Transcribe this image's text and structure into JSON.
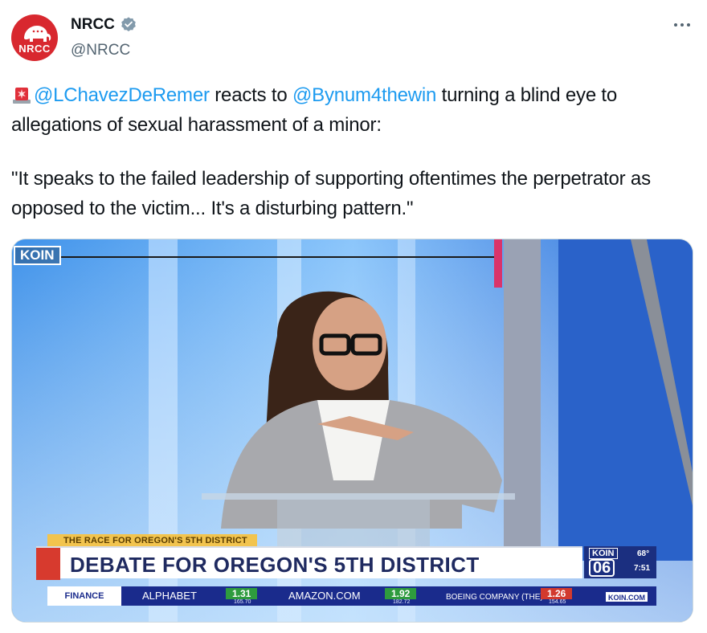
{
  "author": {
    "display_name": "NRCC",
    "handle": "@NRCC",
    "avatar_text": "NRCC",
    "verified": true
  },
  "tweet": {
    "line1_prefix_icon": "rotating-light-emoji",
    "mention_1": "@LChavezDeRemer",
    "text_1": " reacts to ",
    "mention_2": "@Bynum4thewin",
    "text_2": " turning a blind eye to allegations of sexual harassment of a minor:",
    "quote": "\"It speaks to the failed leadership of supporting oftentimes the perpetrator as opposed to the victim... It's a disturbing pattern.\""
  },
  "media": {
    "channel_bug": "KOIN",
    "lower_third_tag": "THE RACE FOR OREGON'S 5TH DISTRICT",
    "lower_third_title": "DEBATE FOR OREGON'S 5TH DISTRICT",
    "station_logo": "KOIN",
    "station_number": "06",
    "temperature": "68°",
    "time": "7:51",
    "ticker_label": "FINANCE",
    "ticker": [
      {
        "name": "ALPHABET",
        "change": "1.31",
        "price": "165.70",
        "color": "#2e9b3e"
      },
      {
        "name": "AMAZON.COM",
        "change": "1.92",
        "price": "182.72",
        "color": "#2e9b3e"
      },
      {
        "name": "BOEING COMPANY (THE)",
        "change": "1.26",
        "price": "154.65",
        "color": "#d23a2e"
      }
    ],
    "ticker_end": "KOIN.COM"
  },
  "colors": {
    "link": "#1d9bf0",
    "brand_red": "#d8282f",
    "verified_blue": "#829aab"
  }
}
